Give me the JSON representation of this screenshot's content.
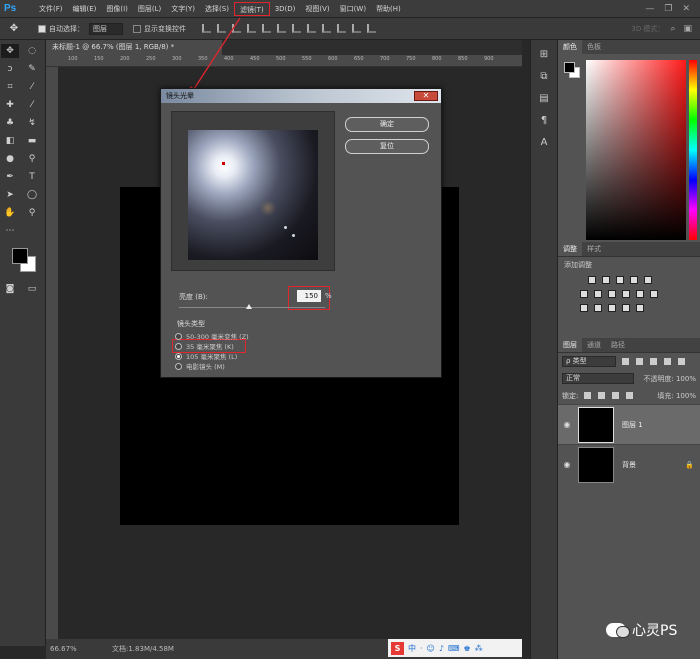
{
  "app": {
    "logo": "Ps"
  },
  "menu": [
    "文件(F)",
    "编辑(E)",
    "图像(I)",
    "图层(L)",
    "文字(Y)",
    "选择(S)",
    "滤镜(T)",
    "3D(D)",
    "视图(V)",
    "窗口(W)",
    "帮助(H)"
  ],
  "menu_highlight_index": 6,
  "window_controls": [
    "—",
    "❐",
    "✕"
  ],
  "options": {
    "auto_select_label": "自动选择：",
    "auto_select_value": "图层",
    "show_transform_label": "显示变换控件",
    "mode3d_label": "3D 模式："
  },
  "document": {
    "tab_title": "未标题-1 @ 66.7% (图层 1, RGB/8) *",
    "ruler_ticks": [
      "100",
      "150",
      "200",
      "250",
      "300",
      "350",
      "400",
      "450",
      "500",
      "550",
      "600",
      "650",
      "700",
      "750",
      "800",
      "850",
      "900"
    ]
  },
  "status": {
    "zoom": "66.67%",
    "doc_info": "文档:1.83M/4.58M"
  },
  "ime": {
    "logo": "S",
    "lang": "中"
  },
  "panels": {
    "color_tabs": [
      "颜色",
      "色板"
    ],
    "adjust_tabs": [
      "调整",
      "样式"
    ],
    "adjust_title": "添加调整",
    "layers_tabs": [
      "图层",
      "通道",
      "路径"
    ],
    "kind_label": "ρ 类型",
    "blend_mode": "正常",
    "opacity_label": "不透明度: 100%",
    "lock_label": "锁定:",
    "fill_label": "填充: 100%",
    "layers": [
      {
        "name": "图层 1",
        "selected": true
      },
      {
        "name": "背景",
        "selected": false,
        "locked": true
      }
    ]
  },
  "dialog": {
    "title": "镜头光晕",
    "ok_label": "确定",
    "reset_label": "复位",
    "brightness_label": "亮度 (B):",
    "brightness_value": "150",
    "brightness_unit": "%",
    "brightness_percent": 150,
    "lens_title": "镜头类型",
    "lens_options": [
      {
        "label": "50-300 毫米变焦 (Z)",
        "selected": false
      },
      {
        "label": "35 毫米聚焦 (K)",
        "selected": false
      },
      {
        "label": "105 毫米聚焦 (L)",
        "selected": true
      },
      {
        "label": "电影镜头 (M)",
        "selected": false
      }
    ]
  },
  "watermark": {
    "text": "心灵PS"
  }
}
